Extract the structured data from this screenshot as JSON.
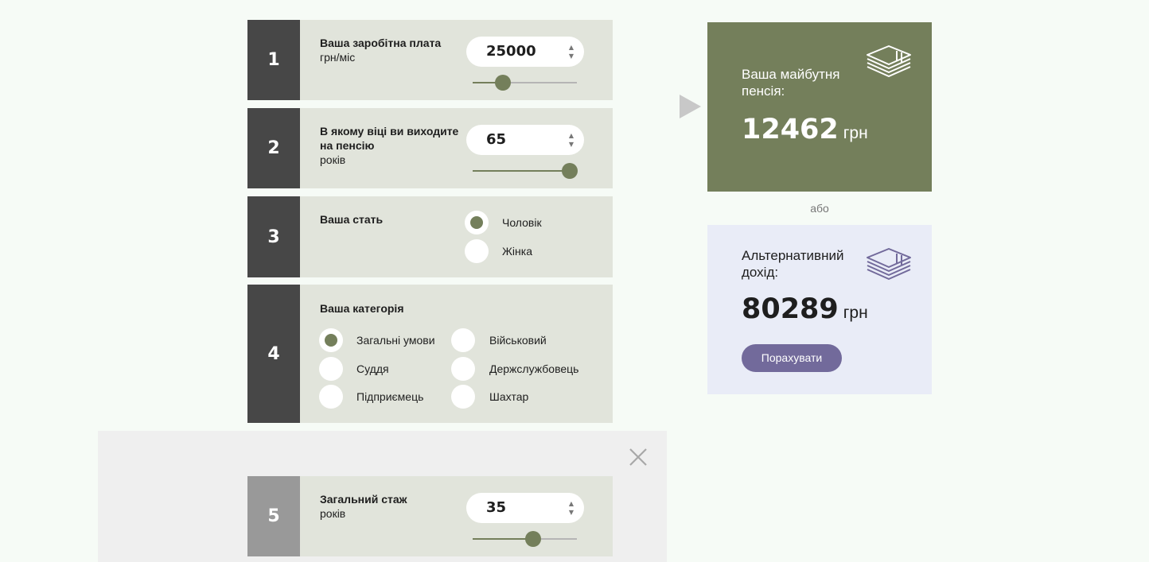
{
  "steps": [
    {
      "number": "1",
      "title": "Ваша заробітна плата",
      "unit": "грн/міс",
      "value": "25000",
      "slider_fraction": 0.29
    },
    {
      "number": "2",
      "title": "В якому віці ви виходите на пенсію",
      "unit": "років",
      "value": "65",
      "slider_fraction": 0.93
    },
    {
      "number": "3",
      "title": "Ваша стать",
      "options": [
        "Чоловік",
        "Жінка"
      ],
      "selected": "Чоловік"
    },
    {
      "number": "4",
      "title": "Ваша категорія",
      "options": [
        "Загальні умови",
        "Військовий",
        "Суддя",
        "Держслужбовець",
        "Підприємець",
        "Шахтар"
      ],
      "selected": "Загальні умови"
    },
    {
      "number": "5",
      "title": "Загальний стаж",
      "unit": "років",
      "value": "35",
      "slider_fraction": 0.58
    }
  ],
  "result": {
    "title": "Ваша майбутня пенсія:",
    "amount": "12462",
    "currency": "грн",
    "icon": "money-stack-icon",
    "color": "#747f5b"
  },
  "separator": "або",
  "alternative": {
    "title": "Альтернативний дохід:",
    "amount": "80289",
    "currency": "грн",
    "icon": "money-stack-icon",
    "button": "Порахувати",
    "button_color": "#726a9b"
  },
  "icons": {
    "close": "close-icon",
    "arrow": "arrow-right-icon",
    "spinner": "spinner-arrows-icon"
  }
}
